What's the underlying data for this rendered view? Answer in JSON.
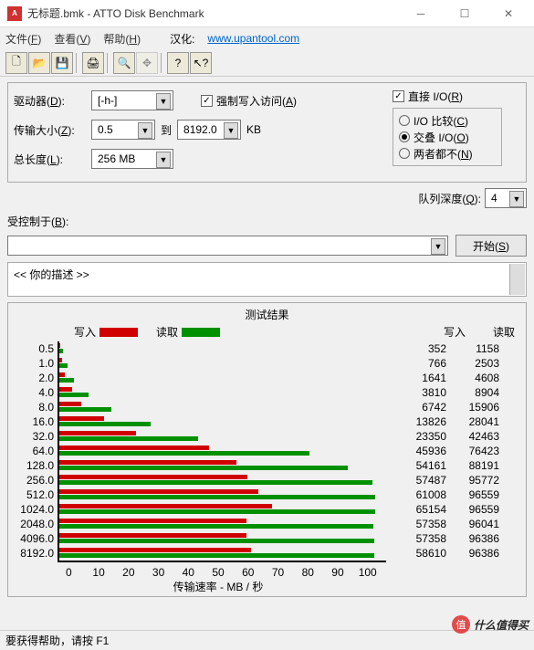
{
  "window": {
    "title": "无标题.bmk - ATTO Disk Benchmark",
    "icon_text": "ATTO"
  },
  "menu": {
    "file": "文件",
    "file_key": "F",
    "view": "查看",
    "view_key": "V",
    "help": "帮助",
    "help_key": "H",
    "localize": "汉化:",
    "link": "www.upantool.com"
  },
  "toolbar_icons": [
    "new",
    "open",
    "save",
    "print",
    "zoom",
    "move",
    "help",
    "context-help"
  ],
  "settings": {
    "drive_label": "驱动器(",
    "drive_key": "D",
    "drive_suffix": "):",
    "drive_value": "[-h-]",
    "transfer_label": "传输大小(",
    "transfer_key": "Z",
    "transfer_suffix": "):",
    "transfer_from": "0.5",
    "to_label": "到",
    "transfer_to": "8192.0",
    "transfer_unit": "KB",
    "length_label": "总长度(",
    "length_key": "L",
    "length_suffix": "):",
    "length_value": "256 MB",
    "force_write": "强制写入访问(",
    "force_write_key": "A",
    "force_write_suffix": ")",
    "direct_io": "直接 I/O(",
    "direct_io_key": "R",
    "direct_io_suffix": ")",
    "radio_compare": "I/O 比较(",
    "radio_compare_key": "C",
    "radio_compare_suffix": ")",
    "radio_overlap": "交叠 I/O(",
    "radio_overlap_key": "O",
    "radio_overlap_suffix": ")",
    "radio_neither": "两者都不(",
    "radio_neither_key": "N",
    "radio_neither_suffix": ")",
    "queue_label": "队列深度(",
    "queue_key": "Q",
    "queue_suffix": "):",
    "queue_value": "4",
    "controlled_label": "受控制于(",
    "controlled_key": "B",
    "controlled_suffix": "):",
    "start_btn": "开始(",
    "start_key": "S",
    "start_suffix": ")",
    "desc_text": "<<   你的描述    >>"
  },
  "results": {
    "title": "测试结果",
    "write_label": "写入",
    "read_label": "读取",
    "xlabel": "传输速率 - MB / 秒"
  },
  "chart_data": {
    "type": "bar",
    "categories": [
      "0.5",
      "1.0",
      "2.0",
      "4.0",
      "8.0",
      "16.0",
      "32.0",
      "64.0",
      "128.0",
      "256.0",
      "512.0",
      "1024.0",
      "2048.0",
      "4096.0",
      "8192.0"
    ],
    "series": [
      {
        "name": "写入",
        "values": [
          352,
          766,
          1641,
          3810,
          6742,
          13826,
          23350,
          45936,
          54161,
          57487,
          61008,
          65154,
          57358,
          57358,
          58610
        ]
      },
      {
        "name": "读取",
        "values": [
          1158,
          2503,
          4608,
          8904,
          15906,
          28041,
          42463,
          76423,
          88191,
          95772,
          96559,
          96559,
          96041,
          96386,
          96386
        ]
      }
    ],
    "xlabel": "传输速率 - MB / 秒",
    "ylabel": "",
    "xlim": [
      0,
      100
    ],
    "x_ticks": [
      "0",
      "10",
      "20",
      "30",
      "40",
      "50",
      "60",
      "70",
      "80",
      "90",
      "100"
    ]
  },
  "statusbar": "要获得帮助，请按 F1",
  "watermark": {
    "icon": "值",
    "text": "什么值得买"
  }
}
